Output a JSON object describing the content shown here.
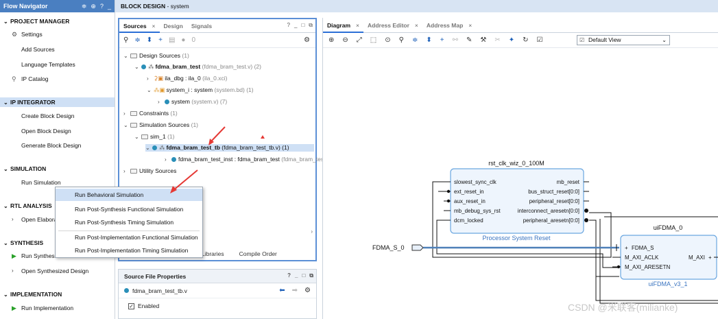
{
  "flow_navigator": {
    "title": "Flow Navigator",
    "header_icons": [
      "≑",
      "⊕",
      "?",
      "_"
    ],
    "sections": {
      "project_manager": "PROJECT MANAGER",
      "ip_integrator": "IP INTEGRATOR",
      "simulation": "SIMULATION",
      "rtl_analysis": "RTL ANALYSIS",
      "synthesis": "SYNTHESIS",
      "implementation": "IMPLEMENTATION"
    },
    "items": {
      "settings": "Settings",
      "add_sources": "Add Sources",
      "language_templates": "Language Templates",
      "ip_catalog": "IP Catalog",
      "create_block_design": "Create Block Design",
      "open_block_design": "Open Block Design",
      "generate_block_design": "Generate Block Design",
      "run_simulation": "Run Simulation",
      "open_elaborated": "Open Elabora",
      "run_synthesis": "Run Synthes",
      "open_synthesized": "Open Synthesized Design",
      "run_implementation": "Run Implementation"
    }
  },
  "topbar": {
    "title": "BLOCK DESIGN",
    "subtitle": " - system"
  },
  "sources_panel": {
    "tabs": [
      "Sources",
      "Design",
      "Signals"
    ],
    "controls": [
      "?",
      "_",
      "□",
      "⧉"
    ],
    "badge": "0",
    "tree": {
      "design_sources": "Design Sources",
      "design_sources_count": "(1)",
      "top": "fdma_bram_test",
      "top_file": "(fdma_bram_test.v) (2)",
      "ila": "ila_dbg : ila_0",
      "ila_file": "(ila_0.xci)",
      "system_i": "system_i : system",
      "system_i_file": "(system.bd) (1)",
      "system": "system",
      "system_file": "(system.v) (7)",
      "constraints": "Constraints",
      "constraints_count": "(1)",
      "sim_sources": "Simulation Sources",
      "sim_sources_count": "(1)",
      "sim_1": "sim_1",
      "sim_1_count": "(1)",
      "tb": "fdma_bram_test_tb",
      "tb_file": "(fdma_bram_test_tb.v) (1)",
      "inst": "fdma_bram_test_inst : fdma_bram_test",
      "inst_file": "(fdma_bram_tes",
      "utility": "Utility Sources"
    },
    "bottom_tabs": [
      "Libraries",
      "Compile Order"
    ]
  },
  "context_menu": {
    "items": [
      "Run Behavioral Simulation",
      "Run Post-Synthesis Functional Simulation",
      "Run Post-Synthesis Timing Simulation",
      "Run Post-Implementation Functional Simulation",
      "Run Post-Implementation Timing Simulation"
    ]
  },
  "properties_panel": {
    "title": "Source File Properties",
    "controls": [
      "?",
      "_",
      "□",
      "⧉"
    ],
    "file": "fdma_bram_test_tb.v",
    "enabled_label": "Enabled",
    "enabled": true
  },
  "diagram_panel": {
    "tabs": [
      "Diagram",
      "Address Editor",
      "Address Map"
    ],
    "view": "Default View",
    "blocks": {
      "rst": {
        "title": "rst_clk_wiz_0_100M",
        "subtitle": "Processor System Reset",
        "inputs": [
          "slowest_sync_clk",
          "ext_reset_in",
          "aux_reset_in",
          "mb_debug_sys_rst",
          "dcm_locked"
        ],
        "outputs": [
          "mb_reset",
          "bus_struct_reset[0:0]",
          "peripheral_reset[0:0]",
          "interconnect_aresetn[0:0]",
          "peripheral_aresetn[0:0]"
        ]
      },
      "fdma": {
        "title": "uiFDMA_0",
        "subtitle": "uiFDMA_v3_1",
        "inputs": [
          "FDMA_S",
          "M_AXI_ACLK",
          "M_AXI_ARESETN"
        ],
        "output": "M_AXI"
      },
      "port": "FDMA_S_0"
    }
  },
  "watermark": "CSDN @米联客(milianke)",
  "colors": {
    "accent": "#4a7fc1",
    "selection": "#cfe0f5",
    "annotation_arrow": "#e53935",
    "block_border": "#6aa6e0",
    "block_fill": "#eef5fd"
  }
}
